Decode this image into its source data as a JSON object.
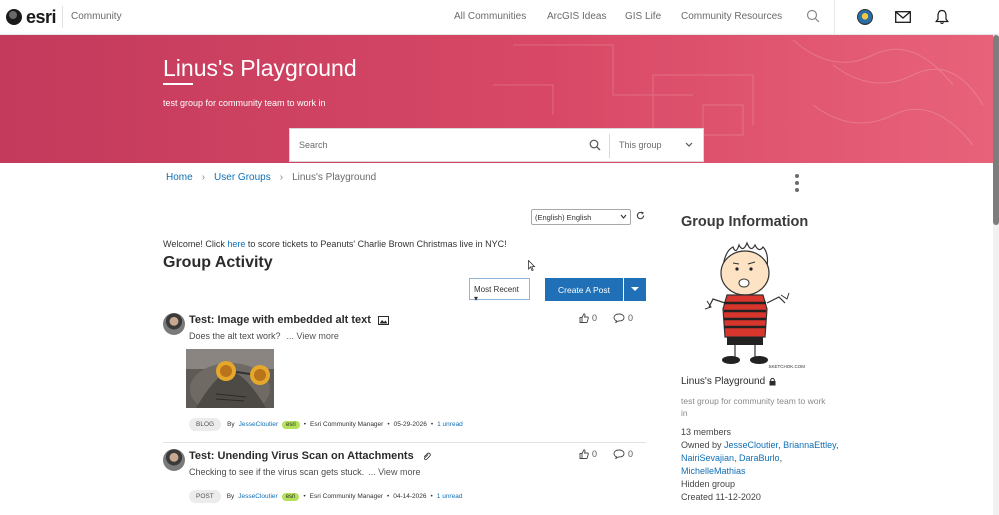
{
  "nav": {
    "logo": "esri",
    "community": "Community",
    "links": [
      "All Communities",
      "ArcGIS Ideas",
      "GIS Life",
      "Community Resources"
    ]
  },
  "hero": {
    "title": "Linus's Playground",
    "subtitle": "test group for community team to work in"
  },
  "search": {
    "placeholder": "Search",
    "scope": "This group"
  },
  "breadcrumb": {
    "home": "Home",
    "groups": "User Groups",
    "current": "Linus's Playground"
  },
  "language": "(English) English",
  "welcome": {
    "before": "Welcome! Click ",
    "link": "here",
    "after": " to score tickets to Peanuts' Charlie Brown Christmas live in NYC!"
  },
  "activity": {
    "title": "Group Activity",
    "sort": "Most Recent",
    "create": "Create A Post"
  },
  "posts": [
    {
      "title": "Test: Image with embedded alt text",
      "body": "Does the alt text work?",
      "more": "... View more",
      "kudos": "0",
      "comments": "0",
      "type": "BLOG",
      "by": "By",
      "author": "JesseCloutier",
      "badge": "esri",
      "role": "Esri Community Manager",
      "date": "05-29-2026",
      "unread": "1 unread"
    },
    {
      "title": "Test: Unending Virus Scan on Attachments",
      "body": "Checking to see if the virus scan gets stuck.",
      "more": "... View more",
      "kudos": "0",
      "comments": "0",
      "type": "POST",
      "by": "By",
      "author": "JesseCloutier",
      "badge": "esri",
      "role": "Esri Community Manager",
      "date": "04-14-2026",
      "unread": "1 unread"
    }
  ],
  "sidebar": {
    "title": "Group Information",
    "name": "Linus's Playground",
    "description": "test group for community team to work in",
    "members": "13 members",
    "owned_by": "Owned by ",
    "owners": [
      "JesseCloutier",
      "BriannaEttley",
      "NairiSevajian",
      "DaraBurlo",
      "MichelleMathias"
    ],
    "visibility": "Hidden group",
    "created": "Created 11-12-2020",
    "image_credit": "SKETCHOK.COM"
  },
  "colors": {
    "hero": "#d84866",
    "link": "#0f6fb5",
    "button": "#1f70b7",
    "badge": "#b4e05a"
  }
}
